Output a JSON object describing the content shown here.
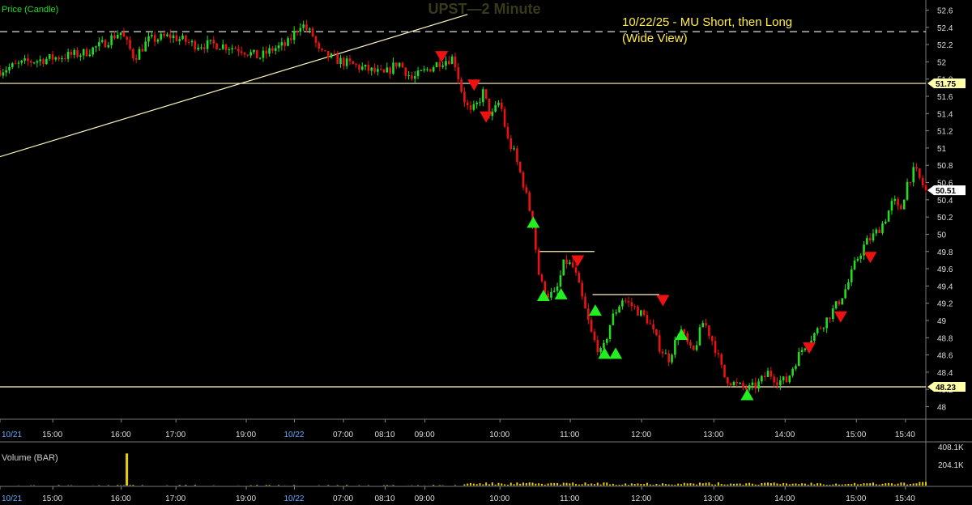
{
  "panels": {
    "price_label": "Price (Candle)",
    "volume_label": "Volume (BAR)"
  },
  "watermark": "UPST—2 Minute",
  "annotation": {
    "line1": "10/22/25 - MU Short, then Long",
    "line2": "(Wide View)"
  },
  "colors": {
    "background": "#000000",
    "up": "#22dd22",
    "down": "#ee1111",
    "level_line": "#fff7c0",
    "annotation_text": "#ffee44",
    "axis_text": "#dddddd",
    "date_text": "#66aaff",
    "volume": "#e8d000",
    "watermark": "#3a3a1a",
    "signal_buy": "#22ee22",
    "signal_sell": "#ee1111"
  },
  "chart_data": {
    "type": "candlestick",
    "symbol": "UPST",
    "interval": "2 Minute",
    "y_ticks": [
      "52.6",
      "52.4",
      "52.2",
      "52",
      "51.8",
      "51.6",
      "51.4",
      "51.2",
      "51",
      "50.8",
      "50.6",
      "50.4",
      "50.2",
      "50",
      "49.8",
      "49.6",
      "49.4",
      "49.2",
      "49",
      "48.8",
      "48.6",
      "48.4",
      "48.2",
      "48"
    ],
    "y_range": [
      47.95,
      52.65
    ],
    "price_badges": [
      {
        "label": "51.75",
        "value": 51.75,
        "style": "level"
      },
      {
        "label": "50.51",
        "value": 50.51,
        "style": "last"
      },
      {
        "label": "48.23",
        "value": 48.23,
        "style": "level"
      }
    ],
    "x_ticks": [
      {
        "label": "10/21",
        "t": 0.0,
        "kind": "date"
      },
      {
        "label": "15:00",
        "t": 0.057
      },
      {
        "label": "16:00",
        "t": 0.131
      },
      {
        "label": "17:00",
        "t": 0.19
      },
      {
        "label": "19:00",
        "t": 0.266
      },
      {
        "label": "10/22",
        "t": 0.318,
        "kind": "date"
      },
      {
        "label": "07:00",
        "t": 0.371
      },
      {
        "label": "08:10",
        "t": 0.416
      },
      {
        "label": "09:00",
        "t": 0.459
      },
      {
        "label": "10:00",
        "t": 0.54
      },
      {
        "label": "11:00",
        "t": 0.616
      },
      {
        "label": "12:00",
        "t": 0.693
      },
      {
        "label": "13:00",
        "t": 0.771
      },
      {
        "label": "14:00",
        "t": 0.848
      },
      {
        "label": "15:00",
        "t": 0.925
      },
      {
        "label": "15:40",
        "t": 0.978
      }
    ],
    "price_path": [
      [
        0.0,
        51.9
      ],
      [
        0.03,
        52.0
      ],
      [
        0.06,
        52.05
      ],
      [
        0.09,
        52.1
      ],
      [
        0.11,
        52.2
      ],
      [
        0.13,
        52.35
      ],
      [
        0.145,
        52.05
      ],
      [
        0.16,
        52.25
      ],
      [
        0.185,
        52.3
      ],
      [
        0.21,
        52.2
      ],
      [
        0.235,
        52.2
      ],
      [
        0.26,
        52.15
      ],
      [
        0.28,
        52.05
      ],
      [
        0.295,
        52.15
      ],
      [
        0.31,
        52.2
      ],
      [
        0.325,
        52.45
      ],
      [
        0.338,
        52.3
      ],
      [
        0.345,
        52.1
      ],
      [
        0.37,
        52.0
      ],
      [
        0.385,
        51.95
      ],
      [
        0.4,
        51.9
      ],
      [
        0.415,
        51.85
      ],
      [
        0.43,
        52.0
      ],
      [
        0.445,
        51.8
      ],
      [
        0.46,
        51.9
      ],
      [
        0.475,
        52.0
      ],
      [
        0.49,
        52.05
      ],
      [
        0.5,
        51.6
      ],
      [
        0.508,
        51.4
      ],
      [
        0.515,
        51.5
      ],
      [
        0.522,
        51.65
      ],
      [
        0.53,
        51.35
      ],
      [
        0.54,
        51.55
      ],
      [
        0.548,
        51.1
      ],
      [
        0.555,
        50.95
      ],
      [
        0.565,
        50.6
      ],
      [
        0.575,
        50.15
      ],
      [
        0.583,
        49.45
      ],
      [
        0.592,
        49.3
      ],
      [
        0.6,
        49.3
      ],
      [
        0.61,
        49.7
      ],
      [
        0.62,
        49.6
      ],
      [
        0.63,
        49.2
      ],
      [
        0.64,
        48.8
      ],
      [
        0.65,
        48.6
      ],
      [
        0.66,
        49.0
      ],
      [
        0.672,
        49.25
      ],
      [
        0.685,
        49.15
      ],
      [
        0.7,
        49.0
      ],
      [
        0.712,
        48.7
      ],
      [
        0.722,
        48.55
      ],
      [
        0.735,
        48.9
      ],
      [
        0.748,
        48.6
      ],
      [
        0.76,
        49.0
      ],
      [
        0.772,
        48.7
      ],
      [
        0.782,
        48.35
      ],
      [
        0.795,
        48.25
      ],
      [
        0.808,
        48.2
      ],
      [
        0.818,
        48.25
      ],
      [
        0.83,
        48.4
      ],
      [
        0.84,
        48.3
      ],
      [
        0.85,
        48.3
      ],
      [
        0.858,
        48.5
      ],
      [
        0.868,
        48.7
      ],
      [
        0.88,
        48.85
      ],
      [
        0.892,
        49.0
      ],
      [
        0.905,
        49.2
      ],
      [
        0.915,
        49.4
      ],
      [
        0.925,
        49.7
      ],
      [
        0.935,
        49.9
      ],
      [
        0.945,
        50.0
      ],
      [
        0.955,
        50.15
      ],
      [
        0.965,
        50.4
      ],
      [
        0.972,
        50.25
      ],
      [
        0.98,
        50.6
      ],
      [
        0.988,
        50.75
      ],
      [
        1.0,
        50.5
      ]
    ],
    "level_lines": [
      {
        "value": 52.35,
        "style": "dashed",
        "from": 0.0,
        "to": 1.0
      },
      {
        "value": 51.75,
        "style": "solid",
        "from": 0.0,
        "to": 1.0
      },
      {
        "value": 48.23,
        "style": "solid",
        "from": 0.0,
        "to": 1.0
      },
      {
        "value": 49.8,
        "style": "solid",
        "from": 0.583,
        "to": 0.642
      },
      {
        "value": 49.3,
        "style": "solid",
        "from": 0.64,
        "to": 0.712
      }
    ],
    "trendline": {
      "from": [
        0.0,
        50.9
      ],
      "to": [
        0.505,
        52.55
      ]
    },
    "signals": [
      {
        "t": 0.477,
        "value": 52.05,
        "type": "sell"
      },
      {
        "t": 0.512,
        "value": 51.72,
        "type": "sell"
      },
      {
        "t": 0.525,
        "value": 51.35,
        "type": "sell"
      },
      {
        "t": 0.576,
        "value": 50.15,
        "type": "buy"
      },
      {
        "t": 0.587,
        "value": 49.3,
        "type": "buy"
      },
      {
        "t": 0.606,
        "value": 49.32,
        "type": "buy"
      },
      {
        "t": 0.624,
        "value": 49.68,
        "type": "sell"
      },
      {
        "t": 0.643,
        "value": 49.13,
        "type": "buy"
      },
      {
        "t": 0.653,
        "value": 48.63,
        "type": "buy"
      },
      {
        "t": 0.665,
        "value": 48.63,
        "type": "buy"
      },
      {
        "t": 0.716,
        "value": 49.22,
        "type": "sell"
      },
      {
        "t": 0.736,
        "value": 48.85,
        "type": "buy"
      },
      {
        "t": 0.807,
        "value": 48.15,
        "type": "buy"
      },
      {
        "t": 0.874,
        "value": 48.67,
        "type": "sell"
      },
      {
        "t": 0.908,
        "value": 49.03,
        "type": "sell"
      },
      {
        "t": 0.94,
        "value": 49.72,
        "type": "sell"
      }
    ],
    "volume_ticks": [
      "408.1K",
      "204.1K"
    ],
    "volume_max": 408100,
    "volume_spikes": [
      {
        "t": 0.137,
        "value": 360000
      }
    ]
  }
}
